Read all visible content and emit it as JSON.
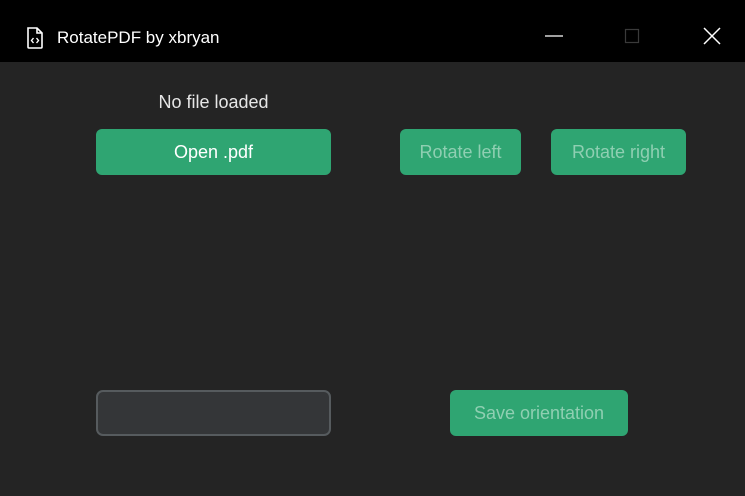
{
  "window": {
    "title": "RotatePDF by xbryan",
    "app_icon": "pdf-file-icon",
    "controls": {
      "minimize": "minimize-icon",
      "maximize": "maximize-icon",
      "close": "close-icon"
    }
  },
  "main": {
    "status_text": "No file loaded",
    "open_button_label": "Open .pdf",
    "rotate_left_label": "Rotate left",
    "rotate_right_label": "Rotate right",
    "filename_input": {
      "value": "",
      "placeholder": ""
    },
    "save_button_label": "Save orientation"
  },
  "colors": {
    "background": "#242424",
    "titlebar": "#000000",
    "accent": "#2fa572",
    "disabled_text": "#8fcfb2",
    "entry_bg": "#343638",
    "entry_border": "#565b5e"
  }
}
